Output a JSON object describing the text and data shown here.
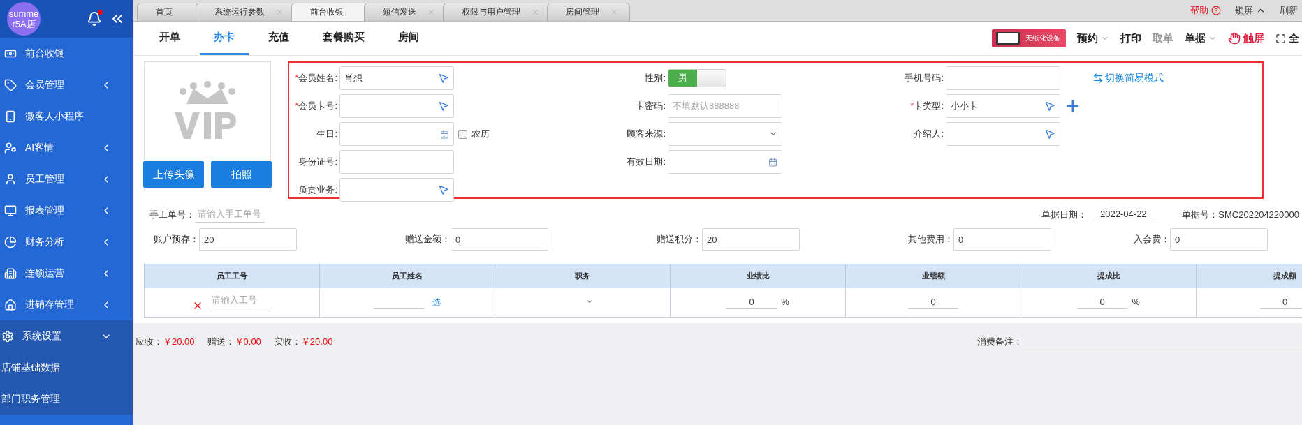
{
  "sidebar": {
    "store": "summer5A店",
    "items": [
      {
        "label": "前台收银"
      },
      {
        "label": "会员管理",
        "expanded": false
      },
      {
        "label": "微客人小程序"
      },
      {
        "label": "AI客情",
        "expanded": false
      },
      {
        "label": "员工管理",
        "expanded": false
      },
      {
        "label": "报表管理",
        "expanded": false
      },
      {
        "label": "财务分析",
        "expanded": false
      },
      {
        "label": "连锁运营",
        "expanded": false
      },
      {
        "label": "进销存管理",
        "expanded": false
      },
      {
        "label": "系统设置",
        "expanded": true,
        "children": [
          {
            "label": "店铺基础数据"
          },
          {
            "label": "部门职务管理"
          }
        ]
      }
    ]
  },
  "page_tabs": [
    {
      "label": "首页",
      "selected": false,
      "closable": false
    },
    {
      "label": "系统运行参数",
      "selected": false,
      "closable": true
    },
    {
      "label": "前台收银",
      "selected": true,
      "closable": false
    },
    {
      "label": "短信发送",
      "selected": false,
      "closable": true
    },
    {
      "label": "权限与用户管理",
      "selected": false,
      "closable": true
    },
    {
      "label": "房间管理",
      "selected": false,
      "closable": true
    }
  ],
  "top_actions": [
    {
      "label": "帮助",
      "kind": "help"
    },
    {
      "label": "锁屏",
      "kind": "lock"
    },
    {
      "label": "刷新",
      "kind": "plain"
    }
  ],
  "sub_tabs": [
    {
      "label": "开单",
      "selected": false
    },
    {
      "label": "办卡",
      "selected": true
    },
    {
      "label": "充值",
      "selected": false
    },
    {
      "label": "套餐购买",
      "selected": false
    },
    {
      "label": "房间",
      "selected": false
    }
  ],
  "device_badge": "无纸化设备",
  "toolbar": [
    {
      "label": "预约",
      "kind": "menu",
      "disabled": false
    },
    {
      "label": "打印",
      "kind": "plain",
      "disabled": false
    },
    {
      "label": "取单",
      "kind": "plain",
      "disabled": true
    },
    {
      "label": "单据",
      "kind": "menu",
      "disabled": false
    },
    {
      "label": "触屏",
      "kind": "touch",
      "disabled": false
    },
    {
      "label": "全",
      "kind": "fullscreen",
      "disabled": false
    }
  ],
  "avatar": {
    "buttons": [
      "上传头像",
      "拍照"
    ]
  },
  "form": {
    "required_mark": "*",
    "rows": [
      [
        {
          "label": "会员姓名:",
          "required": true,
          "kind": "picker",
          "value": "肖想"
        },
        {
          "label": "性别:",
          "required": false,
          "kind": "toggle",
          "value": "男",
          "on": true
        },
        {
          "label": "手机号码:",
          "required": false,
          "kind": "text"
        }
      ],
      [
        {
          "label": "会员卡号:",
          "required": true,
          "kind": "picker"
        },
        {
          "label": "卡密码:",
          "required": false,
          "kind": "text",
          "placeholder": "不填默认888888"
        },
        {
          "label": "卡类型:",
          "required": true,
          "kind": "picker",
          "value": "小小卡",
          "addable": true
        }
      ],
      [
        {
          "label": "生日:",
          "required": false,
          "kind": "date",
          "lunar": {
            "label": "农历",
            "checked": false
          }
        },
        {
          "label": "顾客来源:",
          "required": false,
          "kind": "select"
        },
        {
          "label": "介绍人:",
          "required": false,
          "kind": "picker"
        }
      ],
      [
        {
          "label": "身份证号:",
          "required": false,
          "kind": "text"
        },
        {
          "label": "有效日期:",
          "required": false,
          "kind": "date"
        }
      ],
      [
        {
          "label": "负责业务:",
          "required": false,
          "kind": "picker"
        }
      ]
    ],
    "mode_link": "切换简易模式"
  },
  "manual_no": {
    "label": "手工单号：",
    "placeholder": "请输入手工单号"
  },
  "doc_date": {
    "label": "单据日期：",
    "value": "2022-04-22"
  },
  "doc_no": "单据号：SMC202204220000",
  "amounts": [
    {
      "label": "账户预存：",
      "value": "20"
    },
    {
      "label": "赠送金额：",
      "value": "0"
    },
    {
      "label": "赠送积分：",
      "value": "20"
    },
    {
      "label": "其他费用：",
      "value": "0"
    },
    {
      "label": "入会费：",
      "value": "0"
    }
  ],
  "staff_table": {
    "columns": [
      "员工工号",
      "员工姓名",
      "职务",
      "业绩比",
      "业绩额",
      "提成比",
      "提成额"
    ],
    "rows": [
      {
        "id_placeholder": "请输入工号",
        "pick": "选",
        "perf_ratio": "0",
        "perf_amount": "0",
        "comm_ratio": "0",
        "comm_amount": "0",
        "percent": "%"
      }
    ]
  },
  "totals": [
    {
      "label": "应收：",
      "value": "￥20.00"
    },
    {
      "label": "赠送：",
      "value": "￥0.00"
    },
    {
      "label": "实收：",
      "value": "￥20.00"
    }
  ],
  "remark": {
    "label": "消费备注："
  }
}
